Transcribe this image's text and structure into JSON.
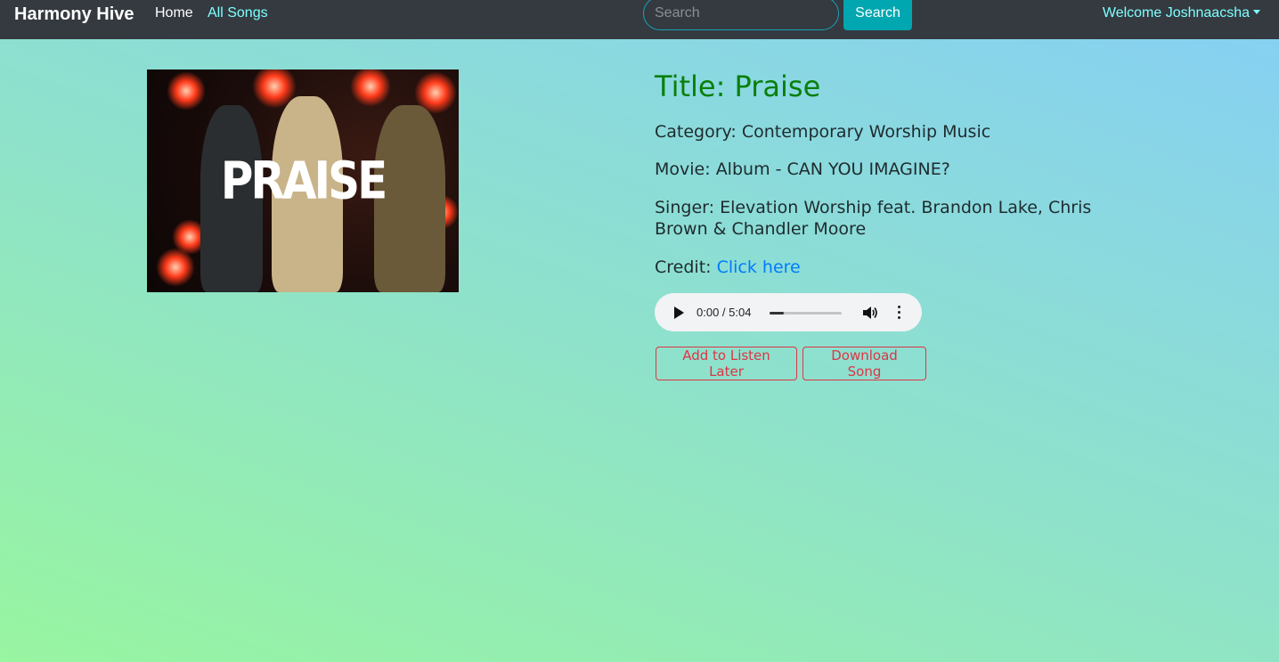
{
  "navbar": {
    "brand": "Harmony Hive",
    "links": [
      {
        "label": "Home"
      },
      {
        "label": "All Songs"
      }
    ],
    "search": {
      "placeholder": "Search",
      "value": "",
      "button_label": "Search"
    },
    "user_menu": {
      "label": "Welcome Joshnaacsha"
    }
  },
  "song": {
    "cover_text": "PRAISE",
    "title": "Title: Praise",
    "category_label": "Category:",
    "category": "Contemporary Worship Music",
    "movie_label": "Movie:",
    "movie": "Album - CAN YOU IMAGINE?",
    "singer_label": "Singer:",
    "singer": "Elevation Worship feat. Brandon Lake, Chris Brown & Chandler Moore",
    "credit_label": "Credit:",
    "credit_link": "Click here"
  },
  "player": {
    "time": "0:00 / 5:04",
    "progress": 0.2
  },
  "actions": {
    "listen_later": "Add to Listen Later",
    "download": "Download Song"
  },
  "colors": {
    "navbar_bg": "#343a40",
    "accent_cyan": "#7fffff",
    "title_green": "#0a7f0a",
    "link_blue": "#007bff",
    "danger": "#dc3545"
  }
}
